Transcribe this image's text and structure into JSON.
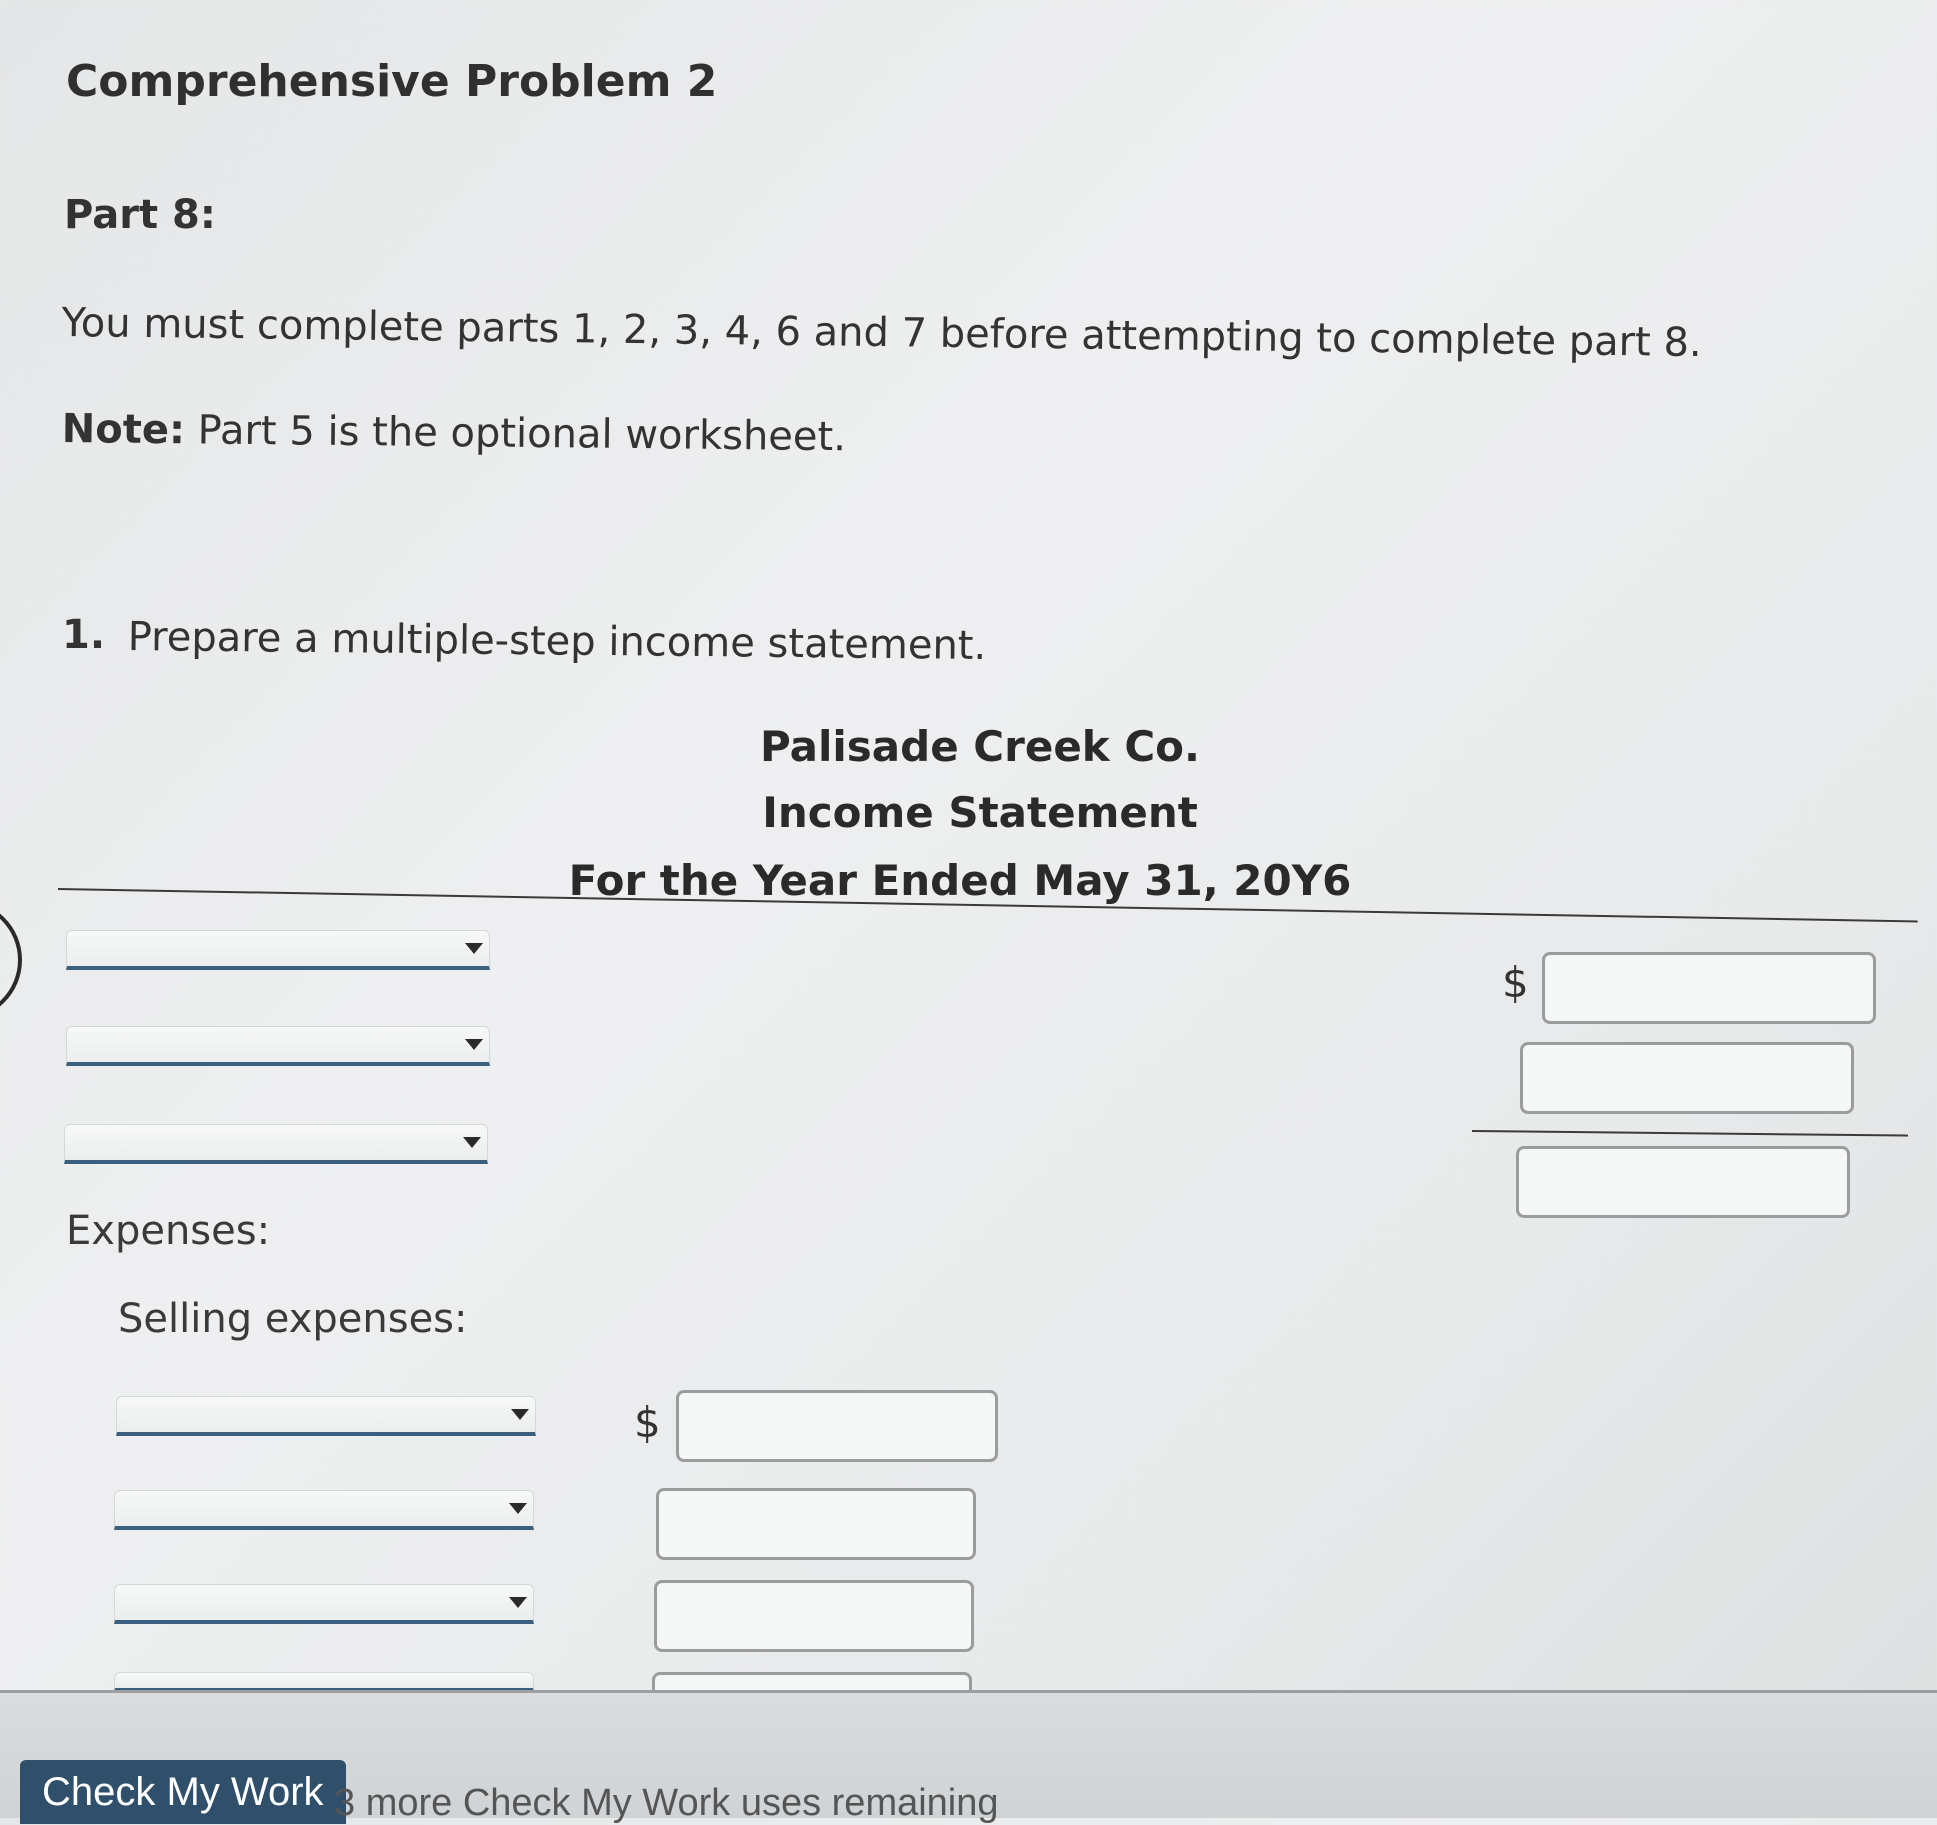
{
  "header": {
    "title": "Comprehensive Problem 2",
    "part": "Part 8:"
  },
  "instructions": {
    "prerequisite": "You must complete parts 1, 2, 3, 4, 6 and 7 before attempting to complete part 8.",
    "note_label": "Note:",
    "note_text": " Part 5 is the optional worksheet."
  },
  "question": {
    "number": "1.",
    "text": "Prepare a multiple-step income statement."
  },
  "statement": {
    "company": "Palisade Creek Co.",
    "title": "Income Statement",
    "period": "For the Year Ended May 31, 20Y6"
  },
  "sections": {
    "expenses": "Expenses:",
    "selling_expenses": "Selling expenses:"
  },
  "currency_symbol": "$",
  "footer": {
    "check_button": "Check My Work",
    "remaining_text": "3 more Check My Work uses remaining"
  }
}
